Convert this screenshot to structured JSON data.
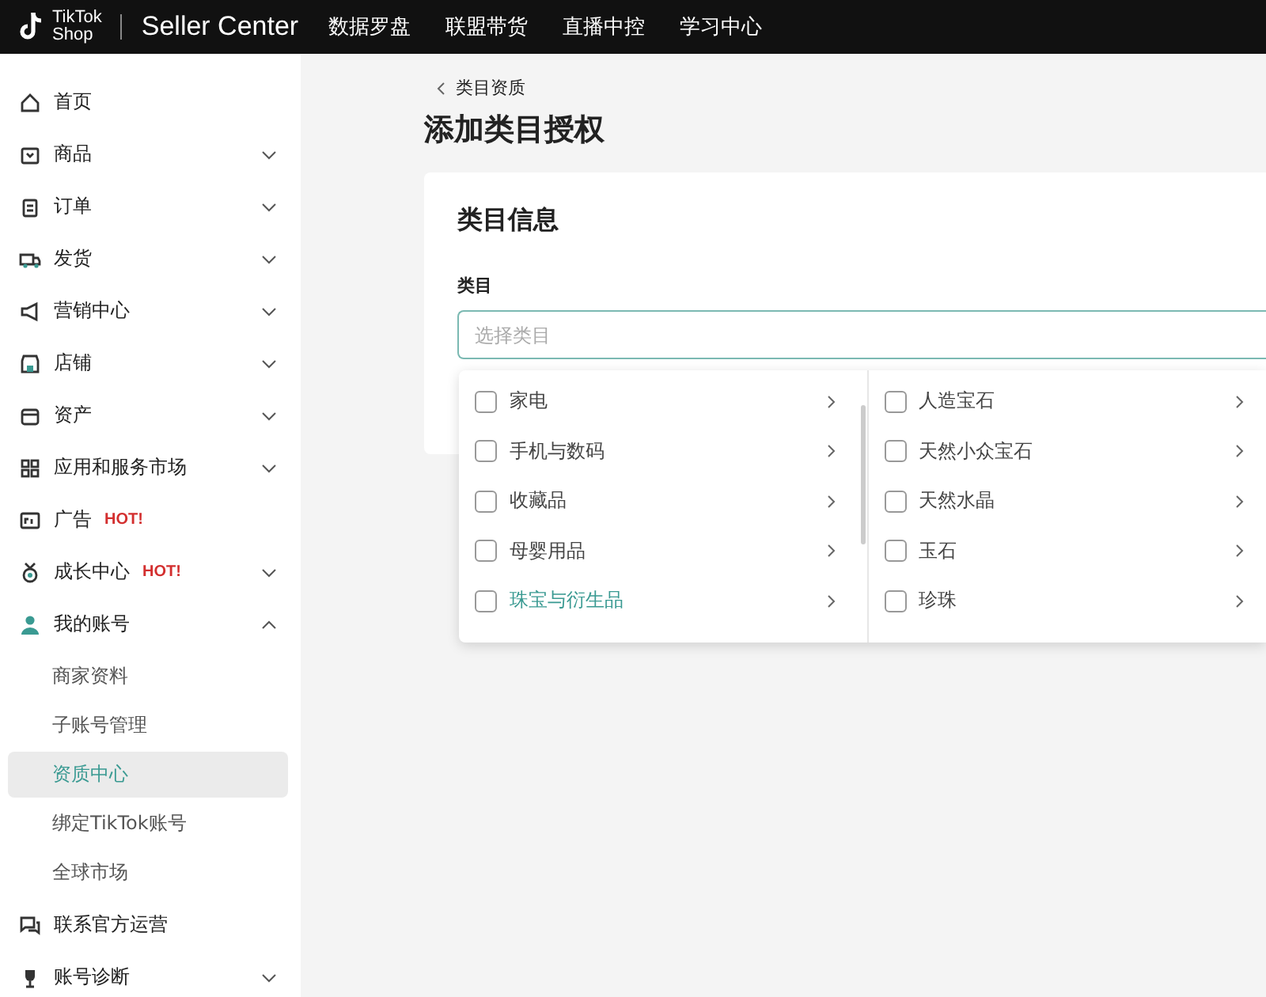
{
  "topbar": {
    "logo_line1": "TikTok",
    "logo_line2": "Shop",
    "product": "Seller Center",
    "nav": [
      "数据罗盘",
      "联盟带货",
      "直播中控",
      "学习中心"
    ]
  },
  "sidebar": {
    "items": [
      {
        "label": "首页",
        "kind": "link"
      },
      {
        "label": "商品",
        "kind": "group",
        "expanded": false
      },
      {
        "label": "订单",
        "kind": "group",
        "expanded": false
      },
      {
        "label": "发货",
        "kind": "group",
        "expanded": false
      },
      {
        "label": "营销中心",
        "kind": "group",
        "expanded": false
      },
      {
        "label": "店铺",
        "kind": "group",
        "expanded": false
      },
      {
        "label": "资产",
        "kind": "group",
        "expanded": false
      },
      {
        "label": "应用和服务市场",
        "kind": "group",
        "expanded": false
      },
      {
        "label": "广告",
        "kind": "link",
        "badge": "HOT!"
      },
      {
        "label": "成长中心",
        "kind": "group",
        "expanded": false,
        "badge": "HOT!"
      },
      {
        "label": "我的账号",
        "kind": "group",
        "expanded": true,
        "children": [
          {
            "label": "商家资料",
            "selected": false
          },
          {
            "label": "子账号管理",
            "selected": false
          },
          {
            "label": "资质中心",
            "selected": true
          },
          {
            "label": "绑定TikTok账号",
            "selected": false
          },
          {
            "label": "全球市场",
            "selected": false
          }
        ]
      },
      {
        "label": "联系官方运营",
        "kind": "link"
      },
      {
        "label": "账号诊断",
        "kind": "group",
        "expanded": false
      }
    ]
  },
  "breadcrumb": "类目资质",
  "page_title": "添加类目授权",
  "card": {
    "title": "类目信息",
    "field_label": "类目",
    "field": {
      "placeholder": "选择类目"
    }
  },
  "dropdown": {
    "columns": [
      [
        {
          "label": "家电",
          "checked": false,
          "selected": false
        },
        {
          "label": "手机与数码",
          "checked": false,
          "selected": false
        },
        {
          "label": "收藏品",
          "checked": false,
          "selected": false
        },
        {
          "label": "母婴用品",
          "checked": false,
          "selected": false
        },
        {
          "label": "珠宝与衍生品",
          "checked": false,
          "selected": true
        }
      ],
      [
        {
          "label": "人造宝石",
          "checked": false,
          "selected": false
        },
        {
          "label": "天然小众宝石",
          "checked": false,
          "selected": false
        },
        {
          "label": "天然水晶",
          "checked": false,
          "selected": false
        },
        {
          "label": "玉石",
          "checked": false,
          "selected": false
        },
        {
          "label": "珍珠",
          "checked": false,
          "selected": false
        }
      ]
    ]
  }
}
